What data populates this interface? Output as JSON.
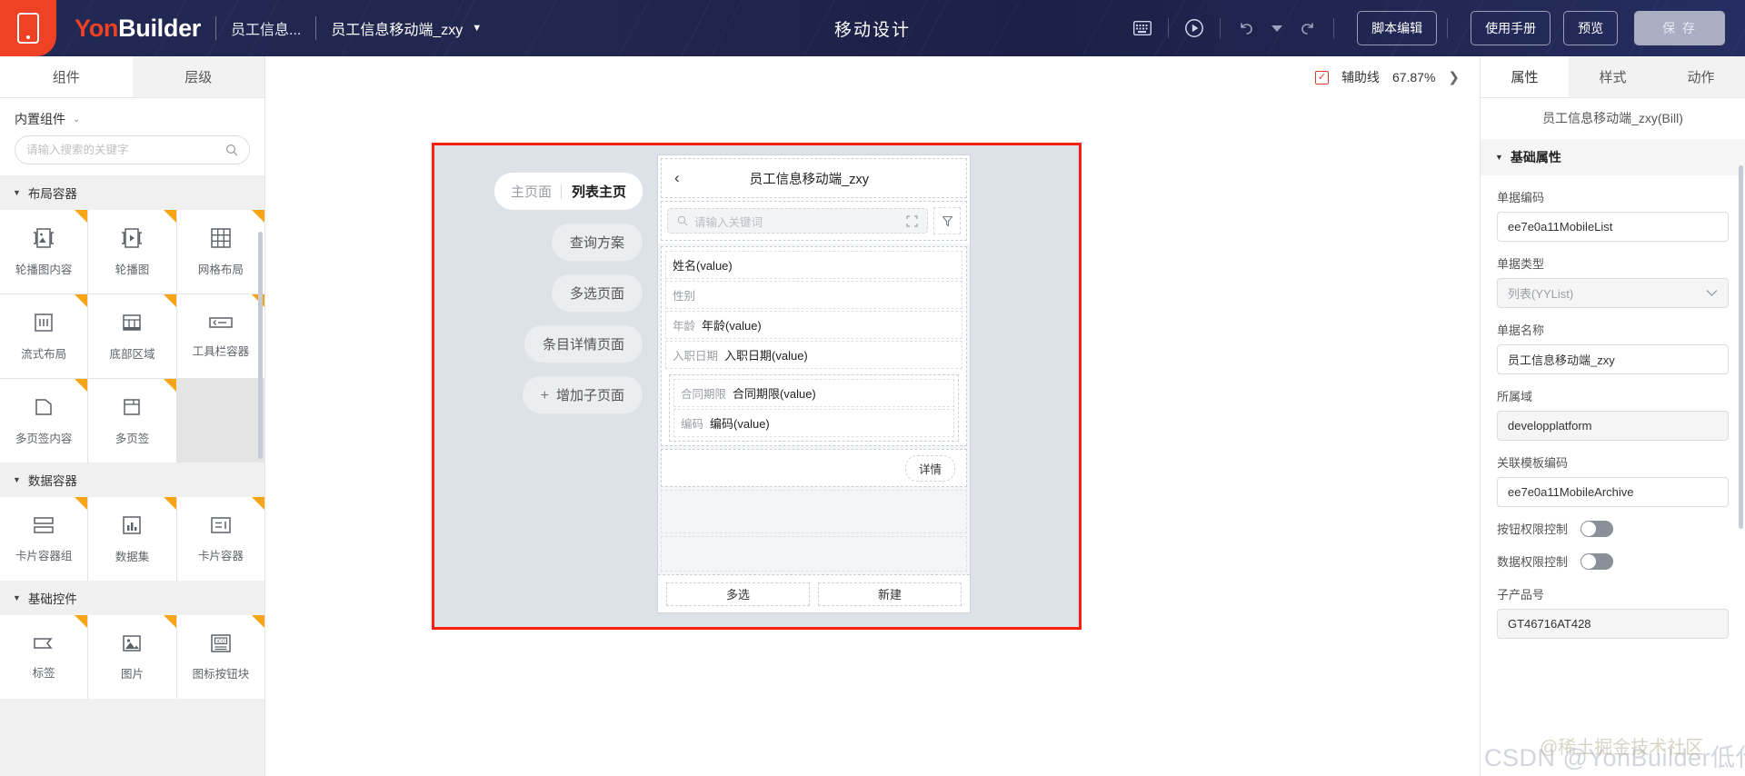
{
  "header": {
    "logo_icon": "mobile-phone-icon",
    "brand_yon": "Yon",
    "brand_builder": "Builder",
    "breadcrumb1": "员工信息...",
    "breadcrumb2": "员工信息移动端_zxy",
    "caret": "▼",
    "center_title": "移动设计",
    "icons": [
      {
        "name": "keyboard-icon",
        "glyph": "⌨"
      },
      {
        "name": "play-circle-icon",
        "glyph": "▶"
      },
      {
        "name": "undo-icon",
        "glyph": "↶"
      },
      {
        "name": "history-dropdown-icon",
        "glyph": "▼"
      },
      {
        "name": "redo-icon",
        "glyph": "↷"
      }
    ],
    "buttons": [
      {
        "name": "script-edit-button",
        "label": "脚本编辑"
      },
      {
        "name": "manual-button",
        "label": "使用手册"
      },
      {
        "name": "preview-button",
        "label": "预览"
      }
    ],
    "save_label": "保 存"
  },
  "left_panel": {
    "tabs": [
      {
        "label": "组件",
        "active": true
      },
      {
        "label": "层级",
        "active": false
      }
    ],
    "subtitle": "内置组件",
    "search_placeholder": "请输入搜索的关键字",
    "search_value": "",
    "groups": [
      {
        "title": "布局容器",
        "items": [
          {
            "label": "轮播图内容",
            "icon": "carousel-content-icon"
          },
          {
            "label": "轮播图",
            "icon": "carousel-icon"
          },
          {
            "label": "网格布局",
            "icon": "grid-layout-icon"
          },
          {
            "label": "流式布局",
            "icon": "flow-layout-icon"
          },
          {
            "label": "底部区域",
            "icon": "bottom-area-icon"
          },
          {
            "label": "工具栏容器",
            "icon": "toolbar-container-icon"
          },
          {
            "label": "多页签内容",
            "icon": "tab-content-icon"
          },
          {
            "label": "多页签",
            "icon": "tabs-icon"
          }
        ]
      },
      {
        "title": "数据容器",
        "items": [
          {
            "label": "卡片容器组",
            "icon": "card-group-icon"
          },
          {
            "label": "数据集",
            "icon": "dataset-icon"
          },
          {
            "label": "卡片容器",
            "icon": "card-container-icon"
          }
        ]
      },
      {
        "title": "基础控件",
        "items": [
          {
            "label": "标签",
            "icon": "label-icon"
          },
          {
            "label": "图片",
            "icon": "image-icon"
          },
          {
            "label": "图标按钮块",
            "icon": "icon-button-block-icon"
          }
        ]
      }
    ]
  },
  "canvas_toolbar": {
    "guideline_label": "辅助线",
    "guideline_checked": true,
    "zoom_level": "67.87%",
    "expand_glyph": "❯"
  },
  "canvas": {
    "frame_color": "#fc1f10",
    "page_list": [
      {
        "label_prefix": "主页面",
        "label": "列表主页",
        "active": true
      },
      {
        "label": "查询方案",
        "active": false
      },
      {
        "label": "多选页面",
        "active": false
      },
      {
        "label": "条目详情页面",
        "active": false
      },
      {
        "label": "增加子页面",
        "active": false,
        "is_add": true,
        "plus": "+"
      }
    ],
    "phone": {
      "back_icon": "chevron-left-icon",
      "title": "员工信息移动端_zxy",
      "search_placeholder": "请输入关键词",
      "search_icon": "search-icon",
      "scan_icon": "scan-icon",
      "filter_icon": "filter-icon",
      "card_rows": [
        {
          "label": "",
          "value": "姓名(value)"
        },
        {
          "label": "",
          "value": "性别"
        },
        {
          "label": "年龄",
          "value": "年龄(value)"
        },
        {
          "label": "入职日期",
          "value": "入职日期(value)"
        }
      ],
      "sub_rows": [
        {
          "label": "合同期限",
          "value": "合同期限(value)"
        },
        {
          "label": "编码",
          "value": "编码(value)"
        }
      ],
      "detail_button": "详情",
      "footer_buttons": [
        "多选",
        "新建"
      ]
    }
  },
  "right_panel": {
    "tabs": [
      {
        "label": "属性",
        "active": true
      },
      {
        "label": "样式",
        "active": false
      },
      {
        "label": "动作",
        "active": false
      }
    ],
    "object_name": "员工信息移动端_zxy(Bill)",
    "section_title": "基础属性",
    "fields": [
      {
        "type": "input",
        "label": "单据编码",
        "value": "ee7e0a11MobileList",
        "readonly": false
      },
      {
        "type": "select",
        "label": "单据类型",
        "value": "列表(YYList)"
      },
      {
        "type": "input",
        "label": "单据名称",
        "value": "员工信息移动端_zxy",
        "readonly": false
      },
      {
        "type": "input",
        "label": "所属域",
        "value": "developplatform",
        "readonly": true
      },
      {
        "type": "input",
        "label": "关联模板编码",
        "value": "ee7e0a11MobileArchive",
        "readonly": false
      }
    ],
    "toggles": [
      {
        "label": "按钮权限控制",
        "on": false
      },
      {
        "label": "数据权限控制",
        "on": false
      }
    ],
    "last_field": {
      "label": "子产品号",
      "value": "GT46716AT428"
    }
  },
  "watermarks": {
    "csdn": "CSDN @YonBuilder低代码开发平台",
    "juejin": "@稀土掘金技术社区"
  }
}
